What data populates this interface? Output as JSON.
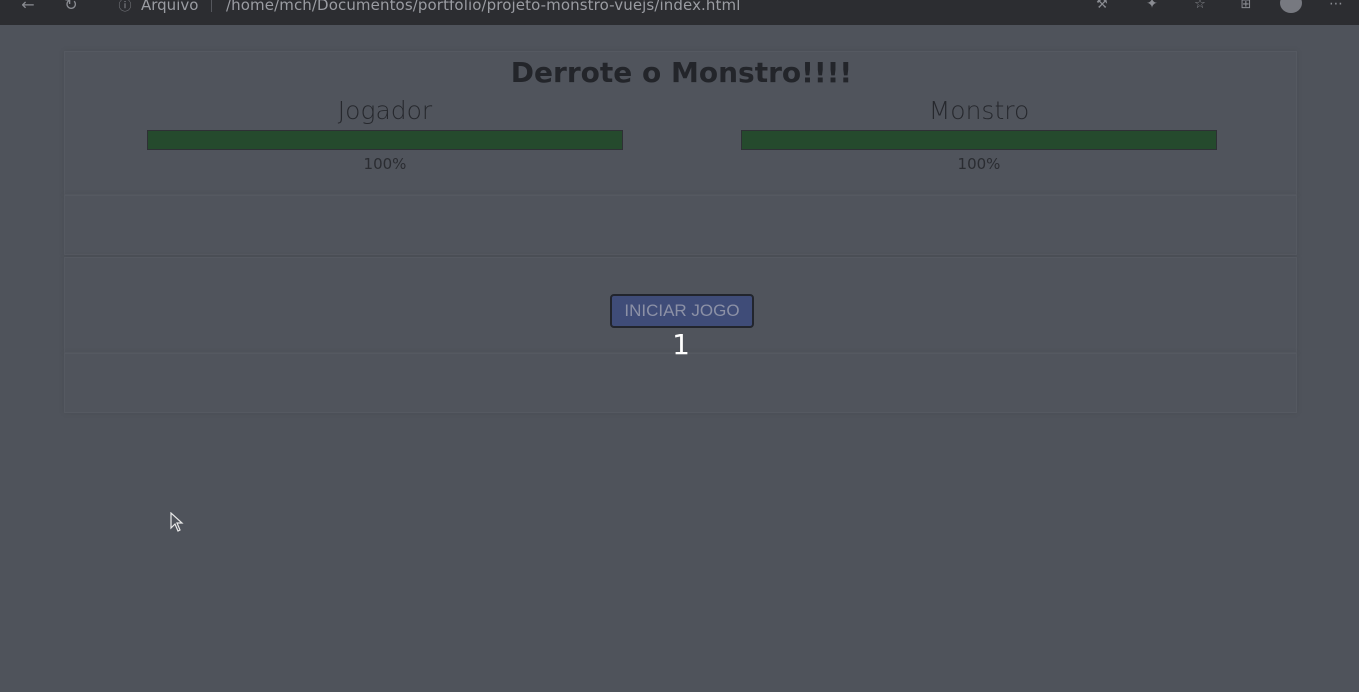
{
  "browser": {
    "back_icon": "back-arrow-icon",
    "reload_icon": "reload-icon",
    "info_label": "Arquivo",
    "url": "/home/mch/Documentos/portfolio/projeto-monstro-vuejs/index.html"
  },
  "game": {
    "title": "Derrote o Monstro!!!!",
    "player": {
      "name": "Jogador",
      "health_percent": 100,
      "health_label": "100%"
    },
    "monster": {
      "name": "Monstro",
      "health_percent": 100,
      "health_label": "100%"
    },
    "start_button_label": "INICIAR JOGO",
    "counter": "1"
  },
  "colors": {
    "background": "#4f535b",
    "health_bar": "#254a2d",
    "button": "#3f4c78"
  }
}
